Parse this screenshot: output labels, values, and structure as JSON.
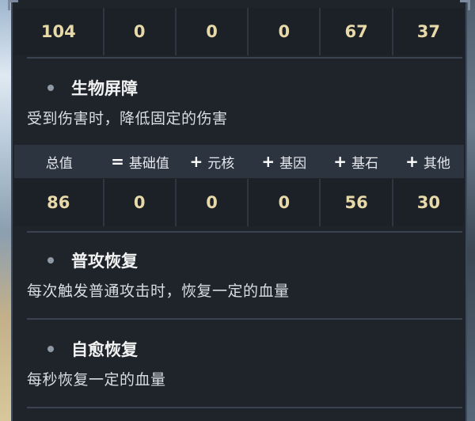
{
  "top_row": [
    "104",
    "0",
    "0",
    "0",
    "67",
    "37"
  ],
  "barrier": {
    "title": "生物屏障",
    "desc": "受到伤害时，降低固定的伤害"
  },
  "formula": {
    "labels": [
      "总值",
      "基础值",
      "元核",
      "基因",
      "基石",
      "其他"
    ],
    "ops": [
      "=",
      "+",
      "+",
      "+",
      "+"
    ]
  },
  "barrier_row": [
    "86",
    "0",
    "0",
    "0",
    "56",
    "30"
  ],
  "attack_heal": {
    "title": "普攻恢复",
    "desc": "每次触发普通攻击时，恢复一定的血量"
  },
  "self_heal": {
    "title": "自愈恢复",
    "desc": "每秒恢复一定的血量"
  }
}
